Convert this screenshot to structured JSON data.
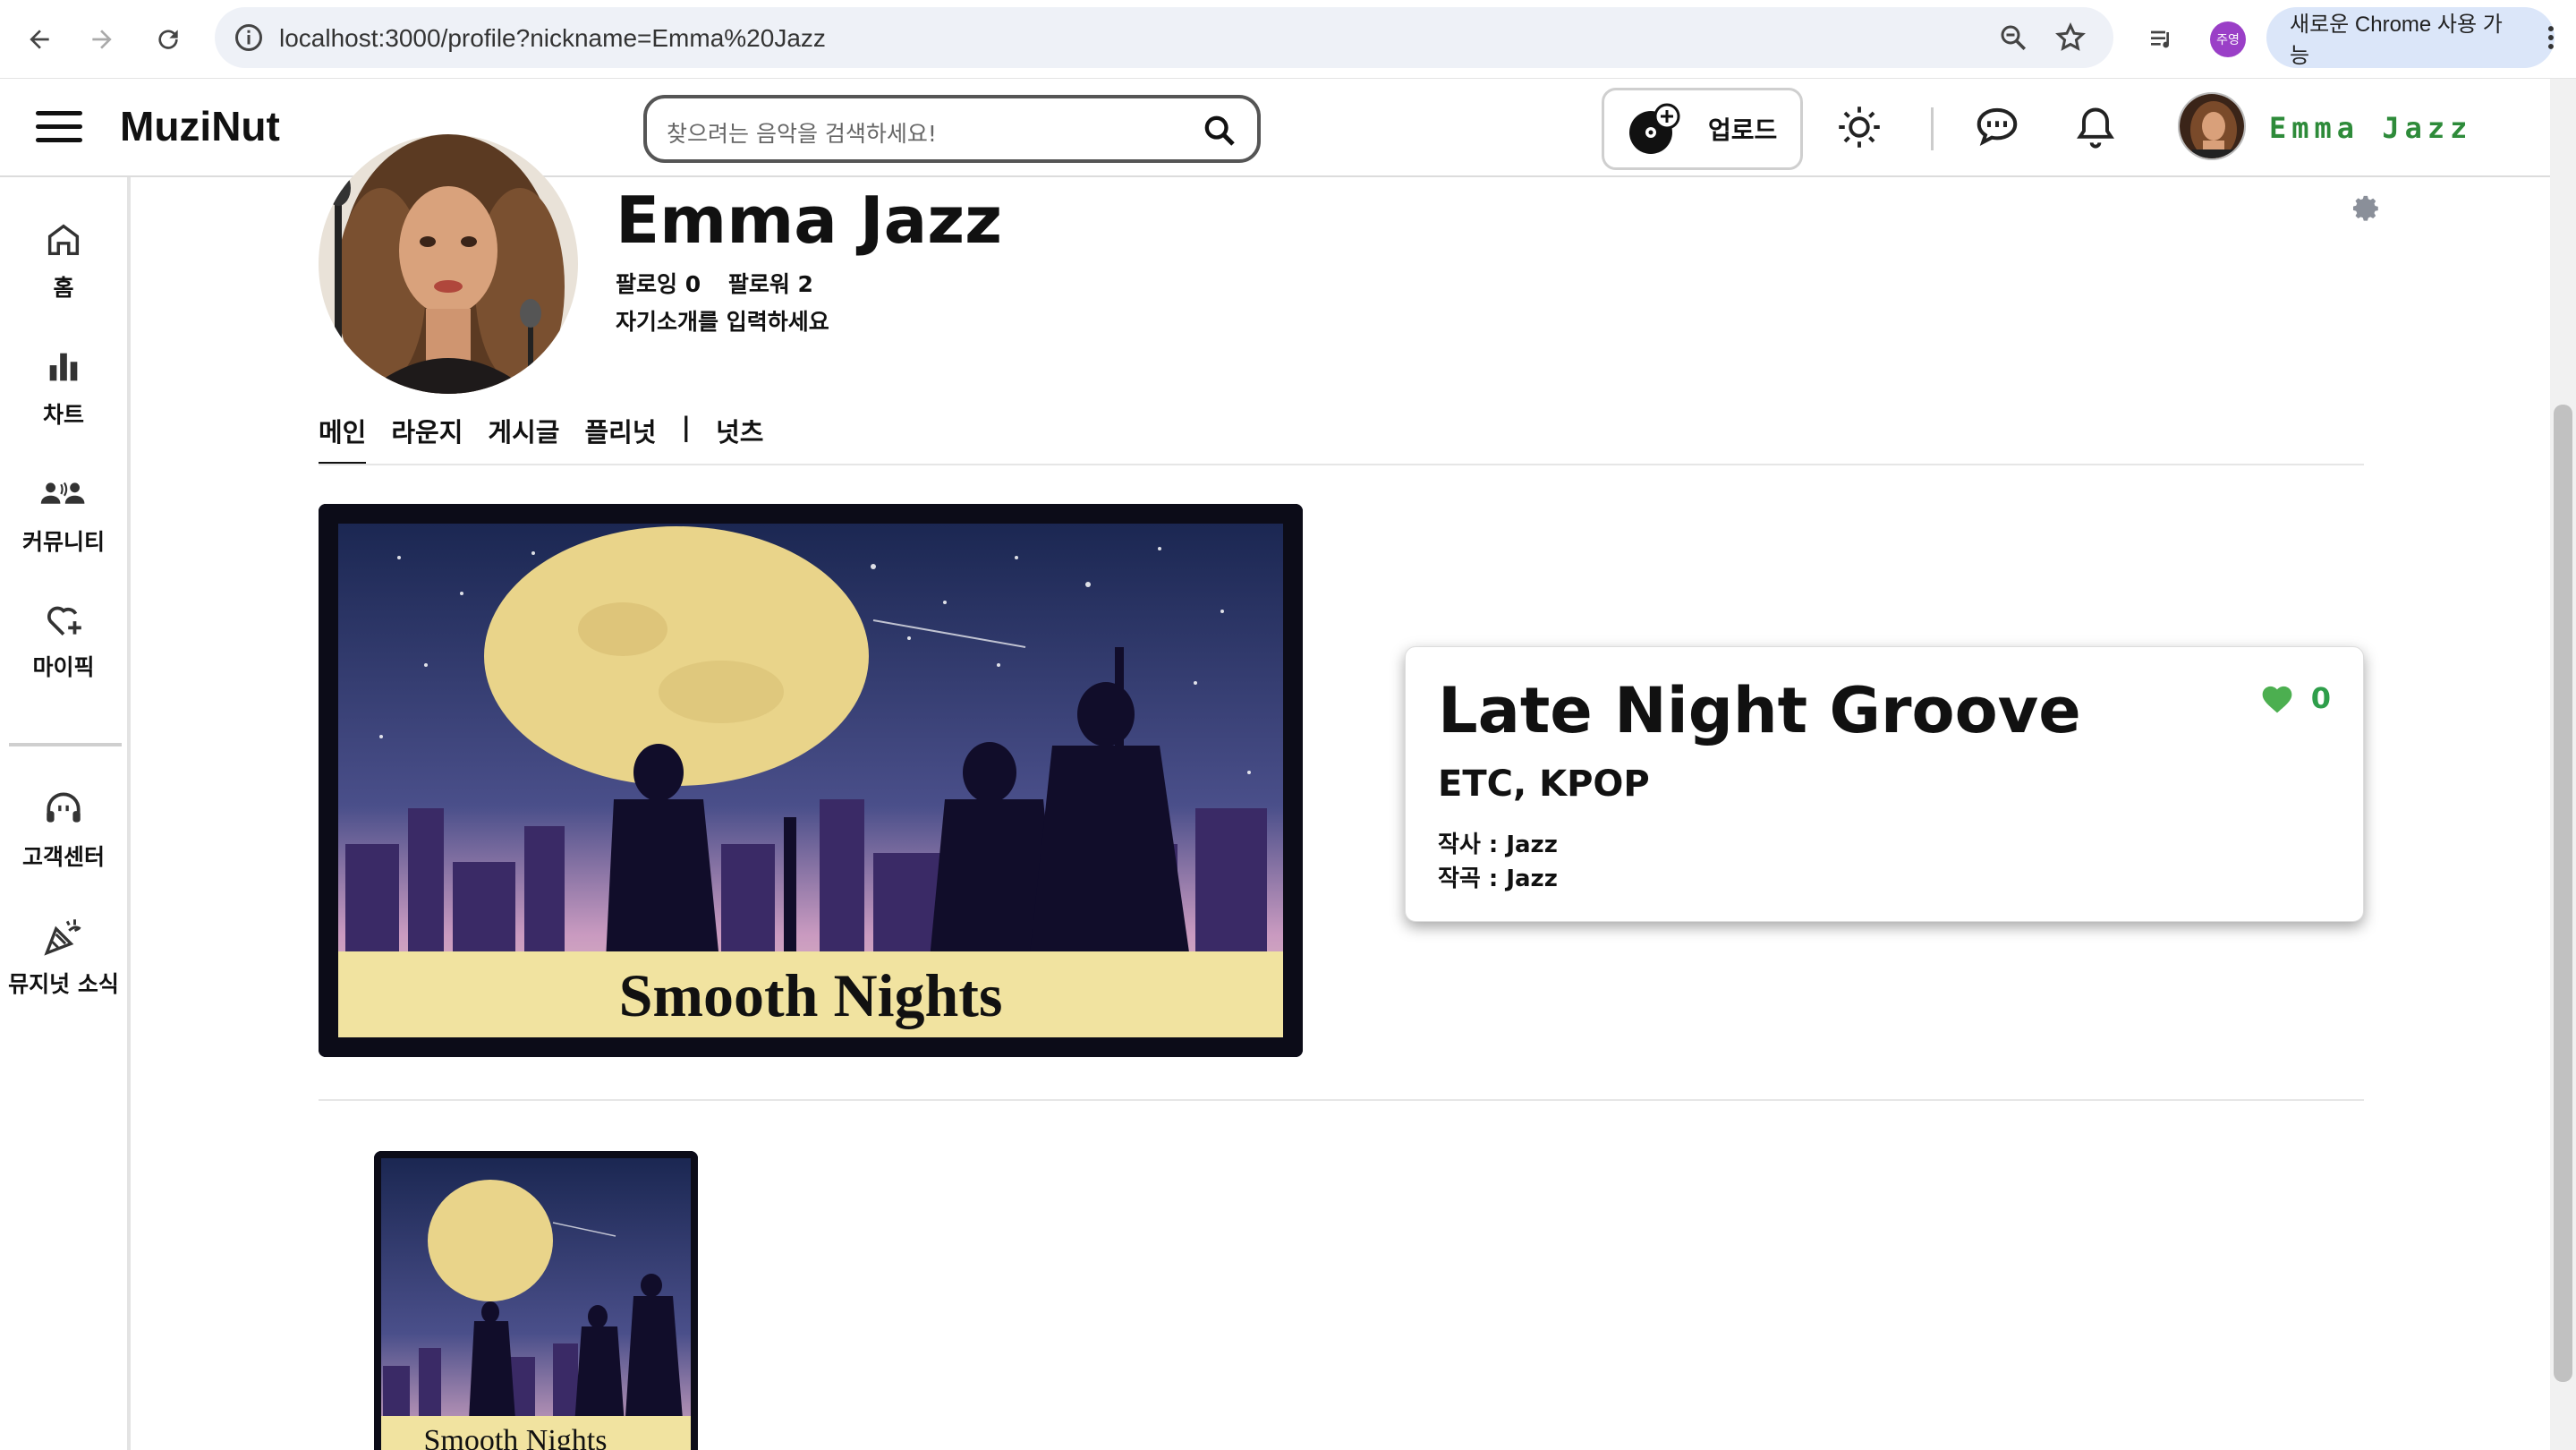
{
  "browser": {
    "url": "localhost:3000/profile?nickname=Emma%20Jazz",
    "profile_chip": "주영",
    "update_pill": "새로운 Chrome 사용 가능"
  },
  "header": {
    "logo": "MuziNut",
    "search_placeholder": "찾으려는 음악을 검색하세요!",
    "upload_label": "업로드",
    "username": "Emma Jazz"
  },
  "sidebar": {
    "items": [
      {
        "label": "홈",
        "icon": "home-icon"
      },
      {
        "label": "차트",
        "icon": "chart-icon"
      },
      {
        "label": "커뮤니티",
        "icon": "community-icon"
      },
      {
        "label": "마이픽",
        "icon": "heart-plus-icon"
      },
      {
        "label": "고객센터",
        "icon": "headset-icon"
      },
      {
        "label": "뮤지넛 소식",
        "icon": "party-icon"
      }
    ]
  },
  "profile": {
    "name": "Emma Jazz",
    "following": "팔로잉 0",
    "followers": "팔로워 2",
    "bio": "자기소개를 입력하세요"
  },
  "tabs": [
    "메인",
    "라운지",
    "게시글",
    "플리넛",
    "|",
    "넛츠"
  ],
  "album": {
    "cover_text": "Smooth Nights"
  },
  "song": {
    "title": "Late Night Groove",
    "genre": "ETC, KPOP",
    "lyricist": "작사 : Jazz",
    "composer": "작곡 : Jazz",
    "likes": "0"
  },
  "colors": {
    "accent_green": "#2e9e4a",
    "username_green": "#2e8b3a"
  }
}
